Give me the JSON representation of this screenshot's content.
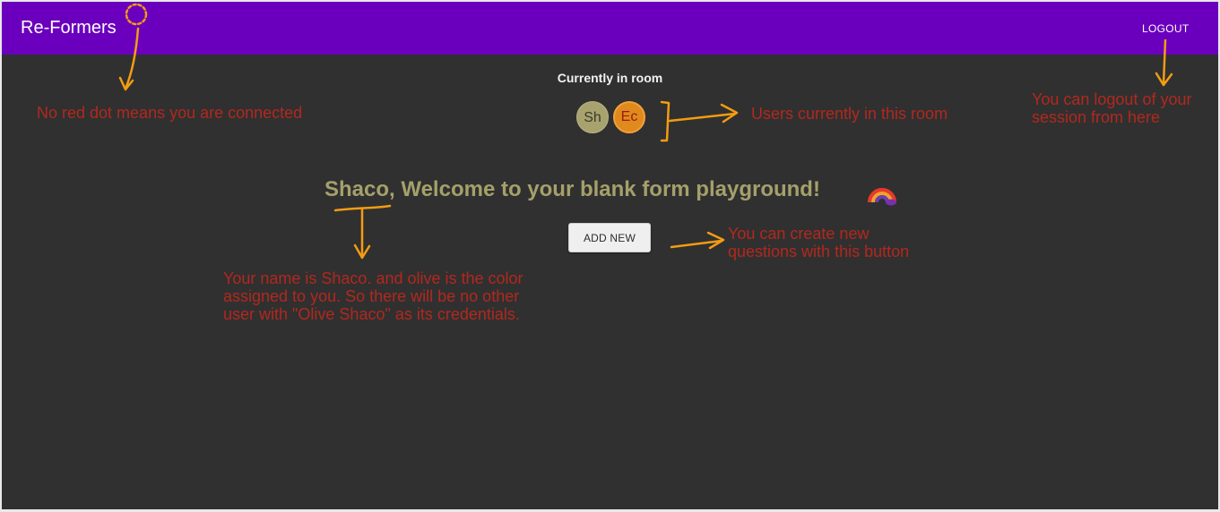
{
  "navbar": {
    "brand": "Re-Formers",
    "logout_label": "LOGOUT",
    "background": "#6a00bd"
  },
  "room": {
    "title": "Currently in room",
    "users": [
      {
        "initials": "Sh",
        "color": "#a8a36e"
      },
      {
        "initials": "Ec",
        "color": "#e08a1e"
      }
    ]
  },
  "main": {
    "welcome": "Shaco, Welcome to your blank form playground!",
    "welcome_icon": "rainbow-icon",
    "add_button_label": "ADD NEW"
  },
  "annotations": {
    "connected_note": "No red dot means you are connected",
    "users_note": "Users currently in this room",
    "logout_note": [
      "You can logout of your",
      "session from here"
    ],
    "add_note": [
      "You can create new",
      "questions with this button"
    ],
    "name_note": [
      "Your name is Shaco. and olive is the color",
      "assigned to you. So there will be no other",
      "user with \"Olive Shaco\" as its credentials."
    ],
    "text_color": "#b2281e",
    "arrow_color": "#f39c12"
  }
}
